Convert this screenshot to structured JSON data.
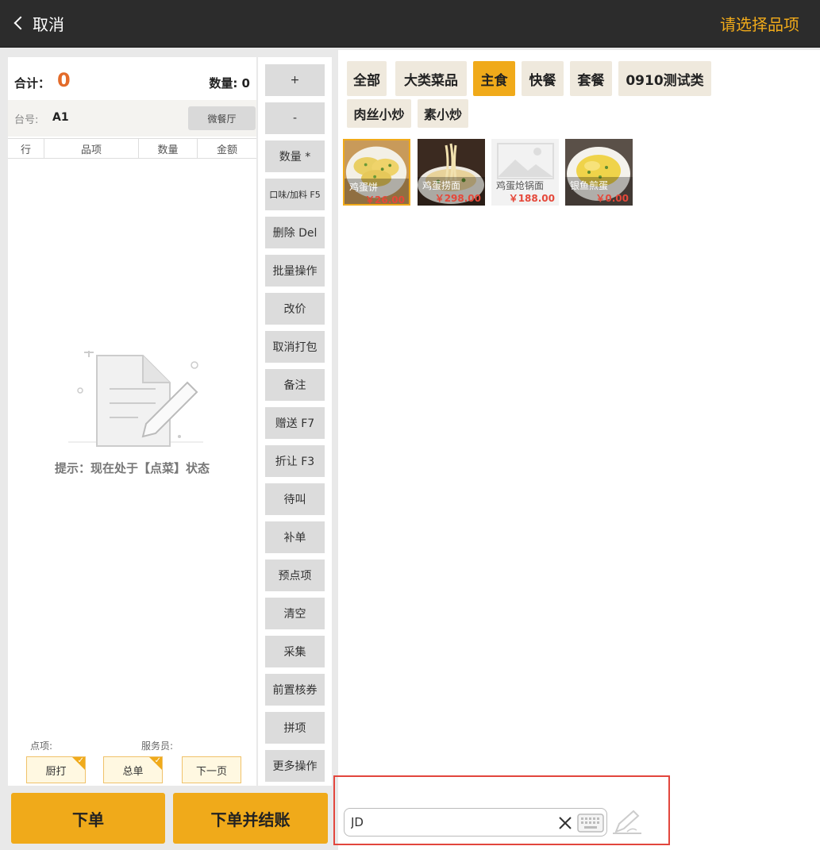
{
  "header": {
    "back_label": "取消",
    "title": "请选择品项"
  },
  "order": {
    "total_label": "合计：",
    "total_value": "0",
    "qty_label": "数量:  0",
    "table_label": "台号:",
    "table_value": "A1",
    "hall_label": "微餐厅",
    "columns": [
      "行",
      "品项",
      "数量",
      "金额"
    ],
    "hint": "提示：现在处于【点菜】状态",
    "dian_label": "点项:",
    "waiter_label": "服务员:",
    "kitchen_print": "厨打",
    "summary": "总单",
    "next_page": "下一页"
  },
  "functions": [
    "+",
    "-",
    "数量 *",
    "口味/加料 F5",
    "删除 Del",
    "批量操作",
    "改价",
    "取消打包",
    "备注",
    "赠送 F7",
    "折让 F3",
    "待叫",
    "补单",
    "预点项",
    "清空",
    "采集",
    "前置核券",
    "拼项",
    "更多操作"
  ],
  "actions": {
    "place_order": "下单",
    "place_and_checkout": "下单并结账"
  },
  "categories": {
    "row1": [
      "全部",
      "大类菜品",
      "主食",
      "快餐",
      "套餐",
      "0910测试类"
    ],
    "row2": [
      "肉丝小炒",
      "素小炒"
    ],
    "active": "主食"
  },
  "dishes": [
    {
      "name": "鸡蛋饼",
      "price": "￥26.00"
    },
    {
      "name": "鸡蛋捞面",
      "price": "￥298.00"
    },
    {
      "name": "鸡蛋炝锅面",
      "price": "￥188.00"
    },
    {
      "name": "银鱼煎蛋",
      "price": "￥0.00"
    }
  ],
  "search": {
    "value": "JD"
  },
  "colors": {
    "accent": "#f0aa1a",
    "total_orange": "#e36b2a",
    "price_red": "#e5483a",
    "highlight_red": "#e2463d"
  }
}
